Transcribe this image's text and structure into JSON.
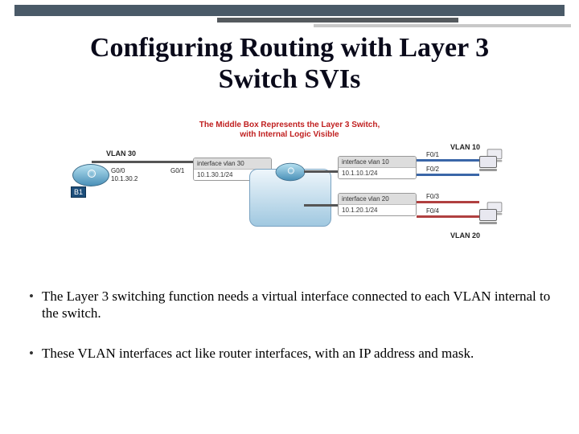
{
  "title_line1": "Configuring Routing with Layer 3",
  "title_line2": "Switch SVIs",
  "diagram": {
    "caption_line1": "The Middle Box Represents the Layer 3 Switch,",
    "caption_line2": "with Internal Logic Visible",
    "left_router_label": "B1",
    "vlan30_label": "VLAN 30",
    "g00_label": "G0/0",
    "g00_ip": "10.1.30.2",
    "g01_label": "G0/1",
    "svi30_hdr": "interface vlan 30",
    "svi30_ip": "10.1.30.1/24",
    "svi10_hdr": "interface vlan 10",
    "svi10_ip": "10.1.10.1/24",
    "svi20_hdr": "interface vlan 20",
    "svi20_ip": "10.1.20.1/24",
    "vlan10_label": "VLAN 10",
    "vlan20_label": "VLAN 20",
    "port_f01": "F0/1",
    "port_f02": "F0/2",
    "port_f03": "F0/3",
    "port_f04": "F0/4"
  },
  "bullets": [
    "The Layer 3 switching function needs a virtual interface connected to each VLAN internal to the switch.",
    "These VLAN interfaces act like router interfaces, with an IP address and mask."
  ]
}
